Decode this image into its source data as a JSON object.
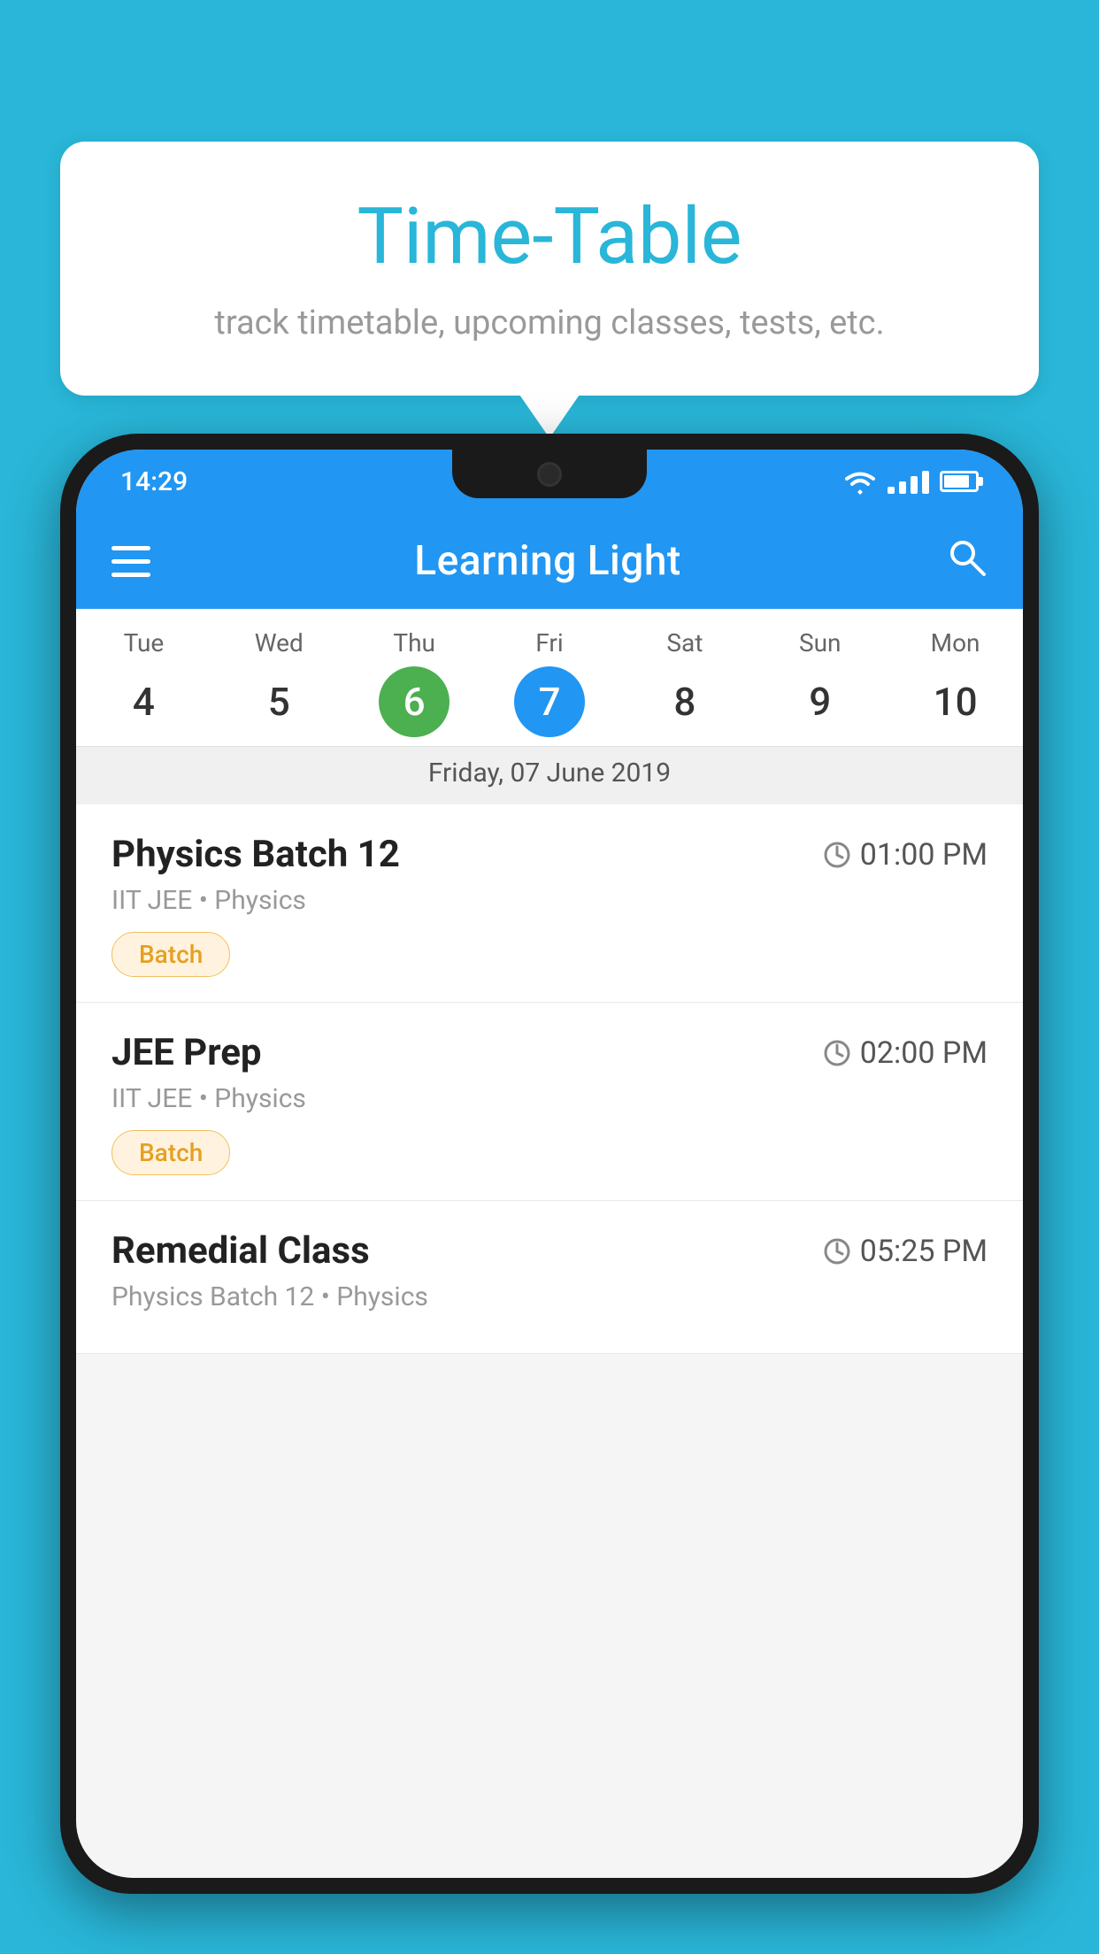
{
  "background_color": "#29b6d8",
  "speech_bubble": {
    "title": "Time-Table",
    "subtitle": "track timetable, upcoming classes, tests, etc."
  },
  "status_bar": {
    "time": "14:29"
  },
  "app_bar": {
    "title": "Learning Light"
  },
  "calendar": {
    "selected_date_label": "Friday, 07 June 2019",
    "days": [
      {
        "name": "Tue",
        "num": "4",
        "state": "normal"
      },
      {
        "name": "Wed",
        "num": "5",
        "state": "normal"
      },
      {
        "name": "Thu",
        "num": "6",
        "state": "today"
      },
      {
        "name": "Fri",
        "num": "7",
        "state": "selected"
      },
      {
        "name": "Sat",
        "num": "8",
        "state": "normal"
      },
      {
        "name": "Sun",
        "num": "9",
        "state": "normal"
      },
      {
        "name": "Mon",
        "num": "10",
        "state": "normal"
      }
    ]
  },
  "classes": [
    {
      "name": "Physics Batch 12",
      "time": "01:00 PM",
      "meta": "IIT JEE • Physics",
      "badge": "Batch"
    },
    {
      "name": "JEE Prep",
      "time": "02:00 PM",
      "meta": "IIT JEE • Physics",
      "badge": "Batch"
    },
    {
      "name": "Remedial Class",
      "time": "05:25 PM",
      "meta": "Physics Batch 12 • Physics",
      "badge": ""
    }
  ],
  "icons": {
    "hamburger": "≡",
    "search": "🔍",
    "clock": "🕐"
  }
}
